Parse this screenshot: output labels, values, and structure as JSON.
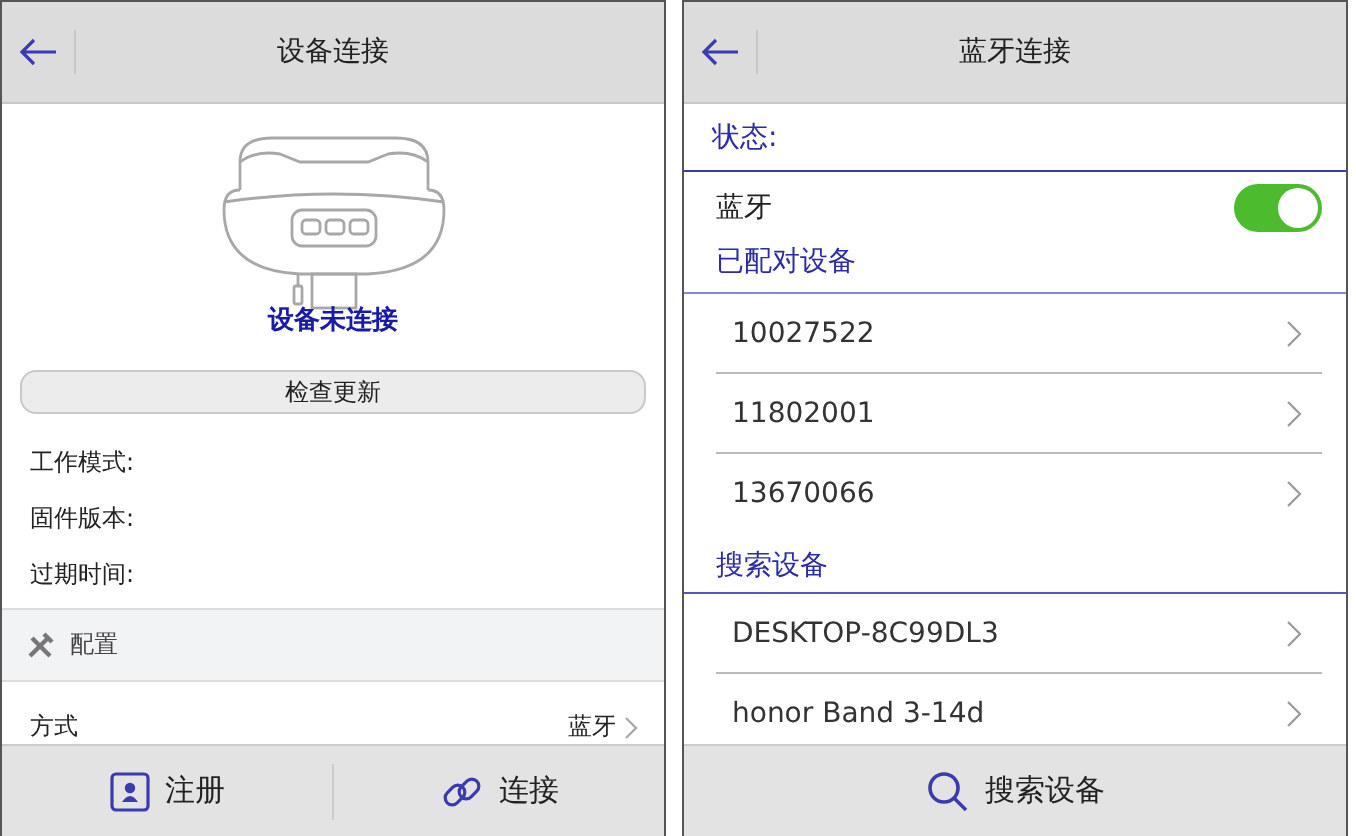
{
  "left": {
    "title": "设备连接",
    "status": "设备未连接",
    "check_button": "检查更新",
    "info": [
      {
        "label": "工作模式:"
      },
      {
        "label": "固件版本:"
      },
      {
        "label": "过期时间:"
      }
    ],
    "section": "配置",
    "setting": {
      "label": "方式",
      "value": "蓝牙"
    },
    "bottom_buttons": [
      {
        "label": "注册",
        "kind": "register"
      },
      {
        "label": "连接",
        "kind": "link"
      }
    ]
  },
  "right": {
    "title": "蓝牙连接",
    "status_label": "状态:",
    "bluetooth": {
      "label": "蓝牙",
      "on": true
    },
    "paired_heading": "已配对设备",
    "paired": [
      "10027522",
      "11802001",
      "13670066"
    ],
    "search_heading": "搜索设备",
    "found": [
      "DESKTOP-8C99DL3",
      "honor Band 3-14d"
    ],
    "search_button": "搜索设备"
  }
}
